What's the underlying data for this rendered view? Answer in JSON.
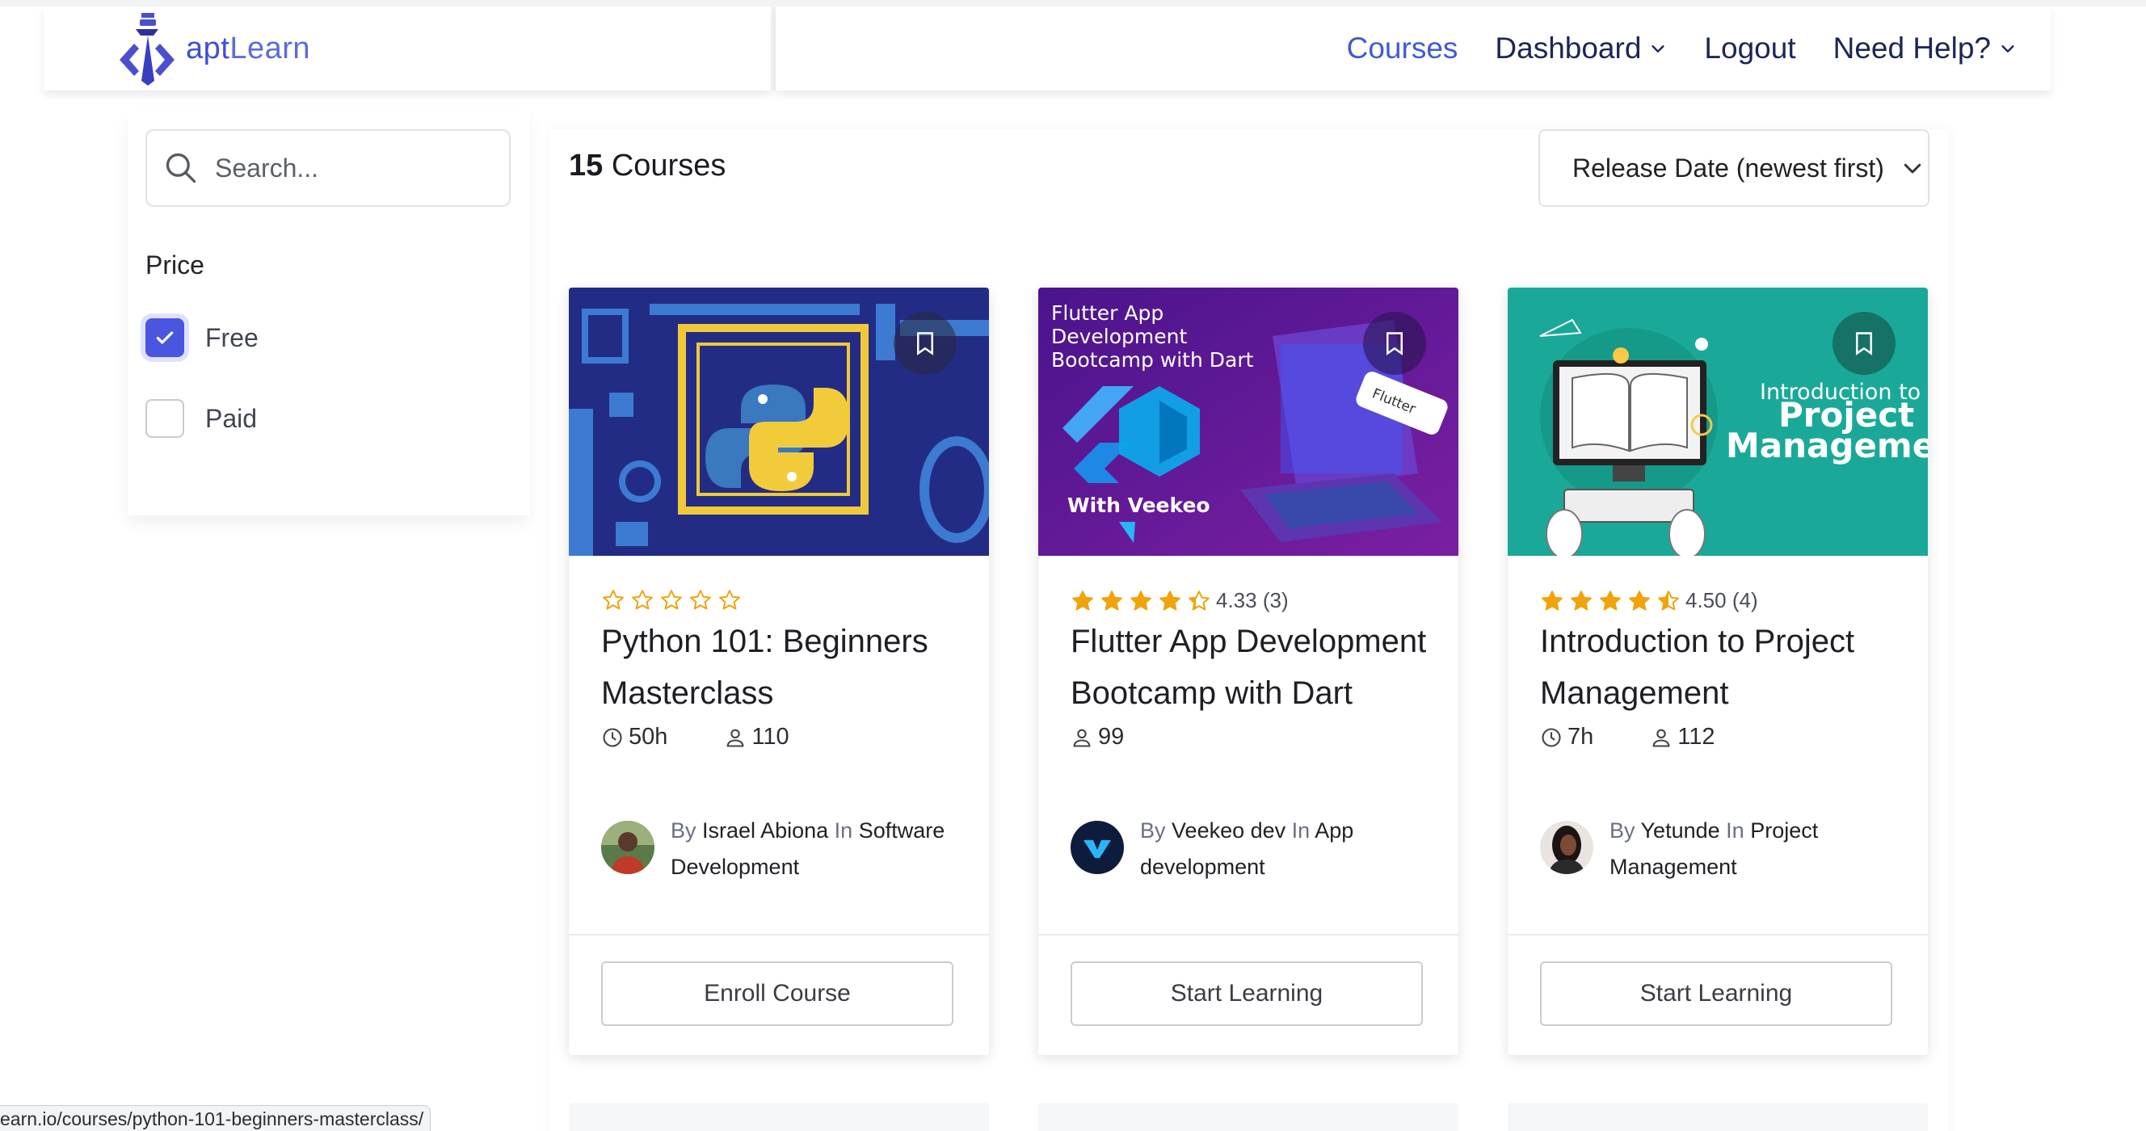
{
  "header": {
    "logo": {
      "part1": "apt",
      "part2": "Learn"
    },
    "nav": [
      {
        "label": "Courses",
        "active": true,
        "dropdown": false
      },
      {
        "label": "Dashboard",
        "active": false,
        "dropdown": true
      },
      {
        "label": "Logout",
        "active": false,
        "dropdown": false
      },
      {
        "label": "Need Help?",
        "active": false,
        "dropdown": true
      }
    ]
  },
  "sidebar": {
    "search_placeholder": "Search...",
    "price_title": "Price",
    "options": [
      {
        "label": "Free",
        "checked": true
      },
      {
        "label": "Paid",
        "checked": false
      }
    ]
  },
  "main": {
    "count_number": "15",
    "count_label": "Courses",
    "sort_label": "Release Date (newest first)"
  },
  "courses": [
    {
      "title": "Python 101: Beginners Masterclass",
      "rating_value": 0,
      "rating_text": "",
      "duration": "50h",
      "students": "110",
      "by": "By",
      "author": "Israel Abiona",
      "in": "In",
      "category": "Software Development",
      "button": "Enroll Course"
    },
    {
      "title": "Flutter App Development Bootcamp with Dart",
      "rating_value": 4.33,
      "rating_text": "4.33 (3)",
      "duration": "",
      "students": "99",
      "by": "By",
      "author": "Veekeo dev",
      "in": "In",
      "category": "App development",
      "button": "Start Learning",
      "thumb_text": [
        "Flutter App",
        "Development",
        "Bootcamp with Dart"
      ],
      "thumb_sub": "With Veekeo",
      "thumb_tag": "Flutter"
    },
    {
      "title": "Introduction to Project Management",
      "rating_value": 4.5,
      "rating_text": "4.50 (4)",
      "duration": "7h",
      "students": "112",
      "by": "By",
      "author": "Yetunde",
      "in": "In",
      "category": "Project Management",
      "button": "Start Learning",
      "thumb_text": [
        "Introduction to",
        "Project",
        "Managemen"
      ]
    }
  ],
  "status_url": "earn.io/courses/python-101-beginners-masterclass/",
  "colors": {
    "brand": "#3e4fd6",
    "nav_text": "#1c2557",
    "star": "#f0a30a",
    "checkbox": "#4a55e0"
  }
}
